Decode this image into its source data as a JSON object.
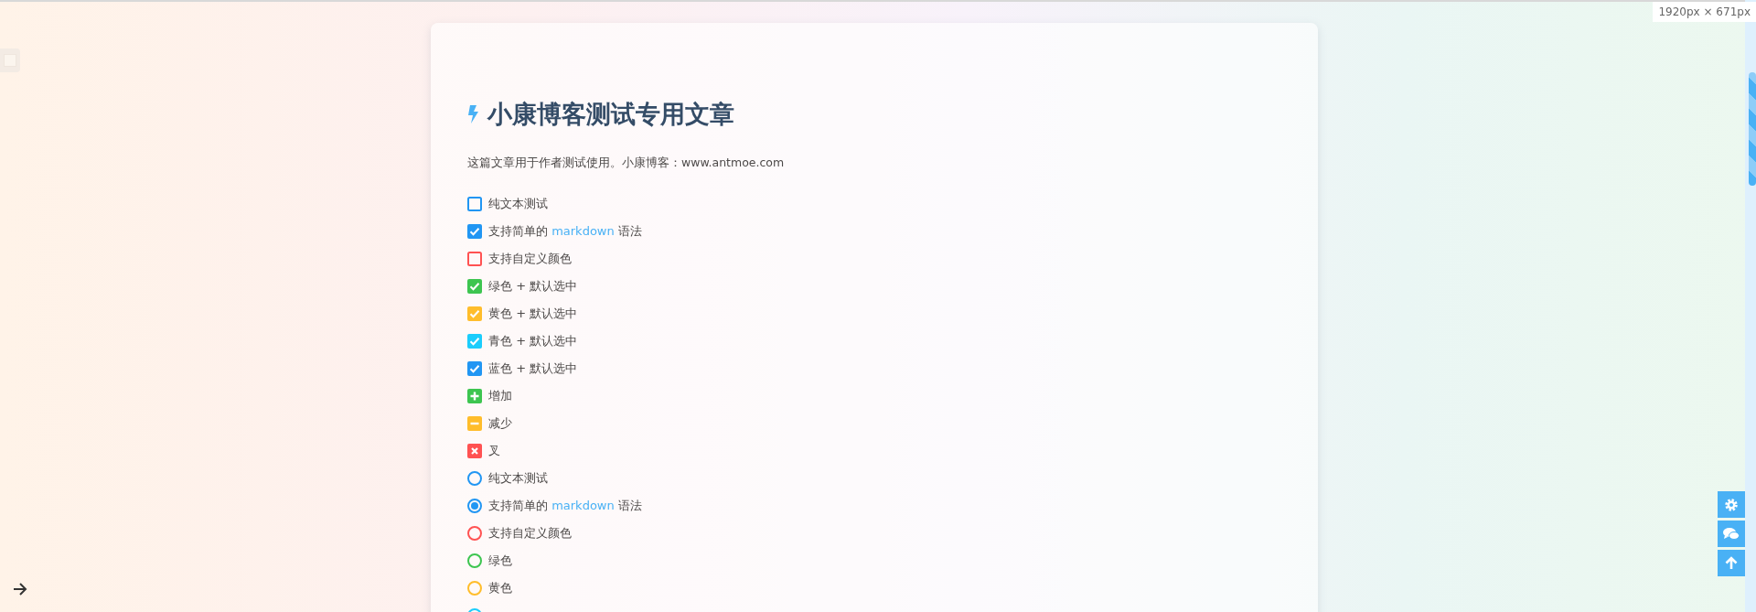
{
  "size_badge": "1920px × 671px",
  "article": {
    "title": "小康博客测试专用文章",
    "intro": "这篇文章用于作者测试使用。小康博客：www.antmoe.com",
    "items": [
      {
        "kind": "checkbox",
        "label": "纯文本测试",
        "checked": false,
        "color": "#2196f3"
      },
      {
        "kind": "checkbox",
        "label": "支持简单的",
        "link": "markdown",
        "label_after": "语法",
        "checked": true,
        "color": "#2196f3"
      },
      {
        "kind": "checkbox",
        "label": "支持自定义颜色",
        "checked": false,
        "color": "#ff5252"
      },
      {
        "kind": "checkbox",
        "label": "绿色 + 默认选中",
        "checked": true,
        "color": "#3dc550"
      },
      {
        "kind": "checkbox",
        "label": "黄色 + 默认选中",
        "checked": true,
        "color": "#ffbd2b"
      },
      {
        "kind": "checkbox",
        "label": "青色 + 默认选中",
        "checked": true,
        "color": "#1bcdfc"
      },
      {
        "kind": "checkbox",
        "label": "蓝色 + 默认选中",
        "checked": true,
        "color": "#2196f3"
      },
      {
        "kind": "plus",
        "label": "增加",
        "color": "#3dc550"
      },
      {
        "kind": "minus",
        "label": "减少",
        "color": "#ffbd2b"
      },
      {
        "kind": "cross",
        "label": "叉",
        "color": "#ff5252"
      },
      {
        "kind": "radio",
        "label": "纯文本测试",
        "selected": false,
        "color": "#2196f3"
      },
      {
        "kind": "radio",
        "label": "支持简单的",
        "link": "markdown",
        "label_after": "语法",
        "selected": true,
        "color": "#2196f3"
      },
      {
        "kind": "radio",
        "label": "支持自定义颜色",
        "selected": false,
        "color": "#ff5252"
      },
      {
        "kind": "radio",
        "label": "绿色",
        "selected": false,
        "color": "#3dc550"
      },
      {
        "kind": "radio",
        "label": "黄色",
        "selected": false,
        "color": "#ffbd2b"
      },
      {
        "kind": "radio",
        "color": "#1bcdfc"
      }
    ]
  }
}
